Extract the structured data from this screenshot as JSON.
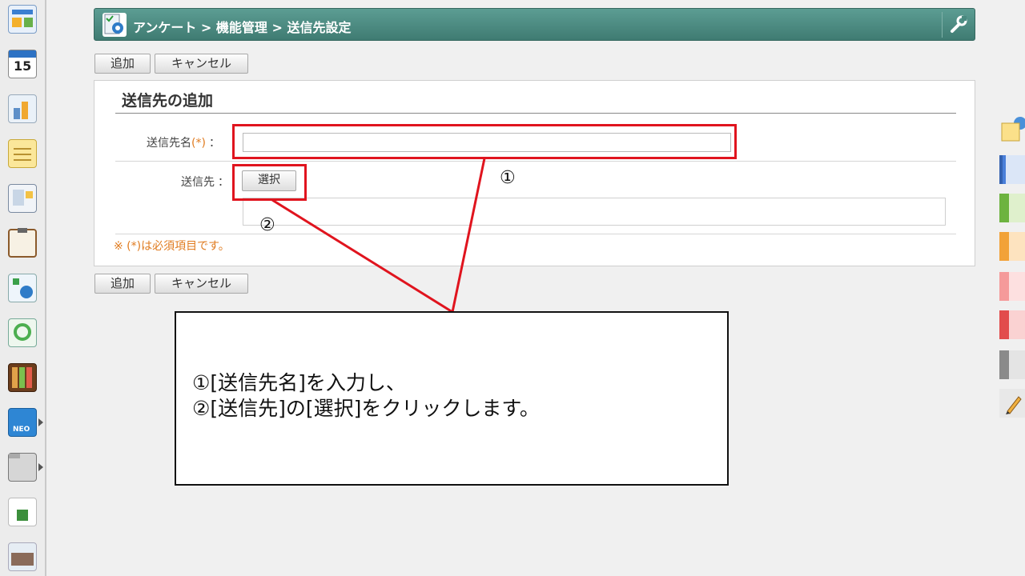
{
  "header": {
    "breadcrumb": "アンケート > 機能管理 > 送信先設定"
  },
  "toolbar": {
    "add_label": "追加",
    "cancel_label": "キャンセル"
  },
  "form": {
    "title": "送信先の追加",
    "name_label": "送信先名",
    "required_mark": "(*)",
    "colon": "：",
    "name_value": "",
    "destination_label": "送信先",
    "select_label": "選択",
    "required_note": "※ (*)は必須項目です。"
  },
  "annotations": {
    "marker_1": "①",
    "marker_2": "②",
    "callout_line1": "①[送信先名]を入力し、",
    "callout_line2": "②[送信先]の[選択]をクリックします。"
  },
  "sidebar": {
    "calendar_day": "15",
    "neo_label": "NEO"
  },
  "colors": {
    "header": "#4a8a80",
    "annotation_red": "#e0141e",
    "required_orange": "#e07b1f"
  }
}
